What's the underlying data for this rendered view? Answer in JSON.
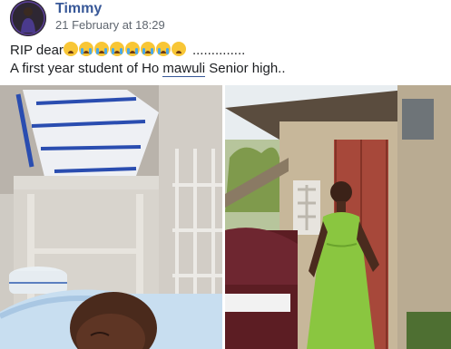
{
  "post": {
    "author": "Timmy",
    "timestamp": "21 February at 18:29",
    "text_prefix": "RIP dear",
    "emojis": [
      "sad-face-emoji",
      "crying-face-emoji",
      "crying-face-emoji",
      "crying-face-emoji",
      "crying-face-emoji",
      "crying-face-emoji",
      "crying-face-emoji",
      "frowning-face-emoji"
    ],
    "text_dots": "..............",
    "line2_before": "A first year student of Ho ",
    "line2_link": "mawuli",
    "line2_after": " Senior high.."
  },
  "colors": {
    "author": "#385898",
    "timestamp": "#606770",
    "body_text": "#1c1e21",
    "dress": "#8ac640",
    "door": "#a84a35"
  }
}
